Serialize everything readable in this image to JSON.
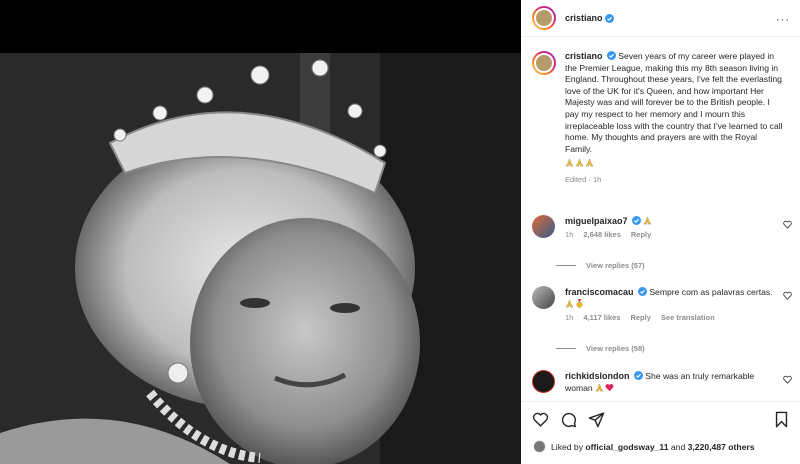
{
  "post": {
    "author": "cristiano",
    "caption": "Seven years of my career were played in the Premier League, making this my 8th season living in England. Throughout these years, I've felt the everlasting love of the UK for it's Queen, and how important Her Majesty was and will forever be to the British people. I pay my respect to her memory and I mourn this irreplaceable loss with the country that I've learned to call home. My thoughts and prayers are with the Royal Family.",
    "caption_emoji": [
      "folded-hands",
      "folded-hands",
      "folded-hands"
    ],
    "edited": "Edited",
    "time": "1h"
  },
  "comments": [
    {
      "username": "miguelpaixao7",
      "text": "",
      "emoji": [
        "folded-hands"
      ],
      "time": "1h",
      "likes": "2,648 likes",
      "reply": "Reply",
      "translate": "",
      "replies": "View replies (57)"
    },
    {
      "username": "franciscomacau",
      "text": "Sempre com as palavras certas.",
      "emoji": [
        "folded-hands",
        "medal"
      ],
      "time": "1h",
      "likes": "4,117 likes",
      "reply": "Reply",
      "translate": "See translation",
      "replies": "View replies (58)"
    },
    {
      "username": "richkidslondon",
      "text": "She was an truly remarkable woman",
      "emoji": [
        "folded-hands",
        "red-heart"
      ],
      "time": "",
      "likes": "",
      "reply": "",
      "translate": "",
      "replies": ""
    }
  ],
  "likes": {
    "prefix": "Liked by",
    "user": "official_godsway_11",
    "and": "and",
    "count": "3,220,487 others"
  },
  "colors": {
    "verified": "#3897f0",
    "text": "#262626",
    "muted": "#8e8e8e",
    "border": "#efefef",
    "heart": "#ed4956"
  }
}
